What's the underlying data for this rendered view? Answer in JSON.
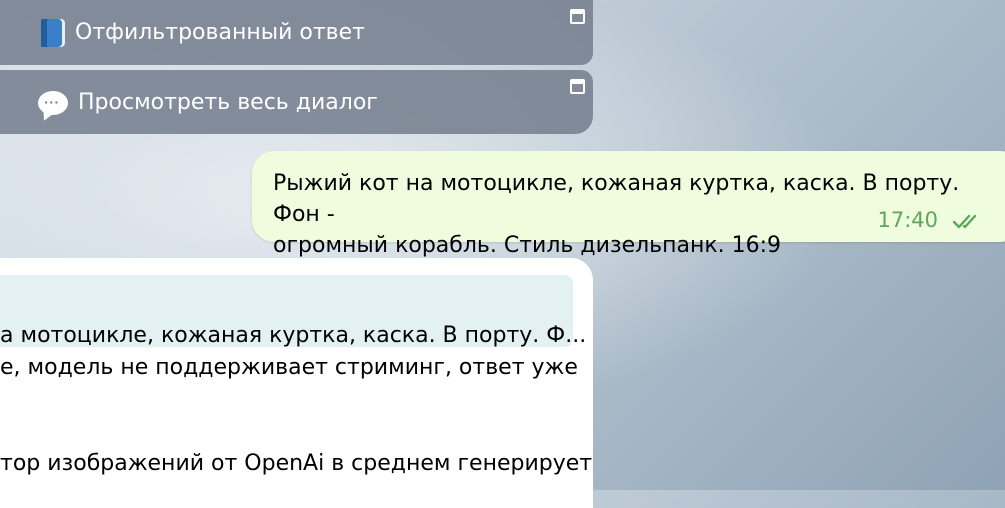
{
  "buttons": [
    {
      "emoji": "book-icon",
      "label": "Отфильтрованный ответ"
    },
    {
      "emoji": "speech-bubble-icon",
      "label": "Просмотреть весь диалог"
    }
  ],
  "outgoing_message": {
    "line1": "Рыжий кот на мотоцикле, кожаная куртка, каска. В порту. Фон -",
    "line2": "огромный корабль. Стиль дизельпанк. 16:9",
    "time": "17:40",
    "status_icon": "double-check-icon"
  },
  "incoming_message": {
    "quote": "а мотоцикле, кожаная куртка, каска. В порту. Ф...",
    "line1": "е, модель не поддерживает стриминг, ответ уже",
    "line2": "тор изображений от OpenAi в среднем генерирует"
  },
  "colors": {
    "button_bg": "#76808e",
    "outgoing_bg": "#effdde",
    "time_color": "#5ea65b",
    "quote_bg": "#e4f1f3"
  }
}
